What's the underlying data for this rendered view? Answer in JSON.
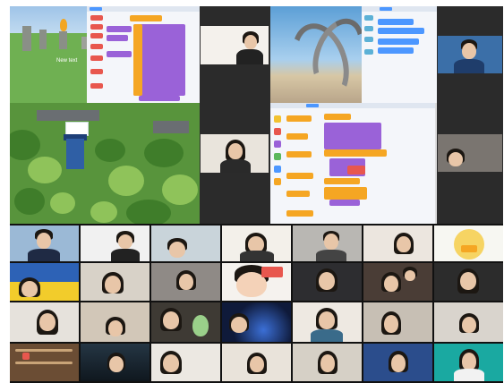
{
  "shared_screens": [
    {
      "name": "scene-a",
      "scene_label": "New text"
    },
    {
      "name": "scene-b"
    },
    {
      "name": "scene-c"
    }
  ],
  "gallery": {
    "rows": 4,
    "columns": 7,
    "participant_count": 34
  },
  "colors": {
    "scratch_purple": "#9a62d8",
    "scratch_orange": "#f5a623",
    "scratch_blue": "#4c97ff",
    "terrain_green": "#5fa04a",
    "dark_bg": "#2b2b2b"
  },
  "icons": [
    "castle-sprite",
    "flame-sprite",
    "ukraine-flag-background",
    "cartoon-duck-avatar",
    "cartoon-avatar"
  ]
}
